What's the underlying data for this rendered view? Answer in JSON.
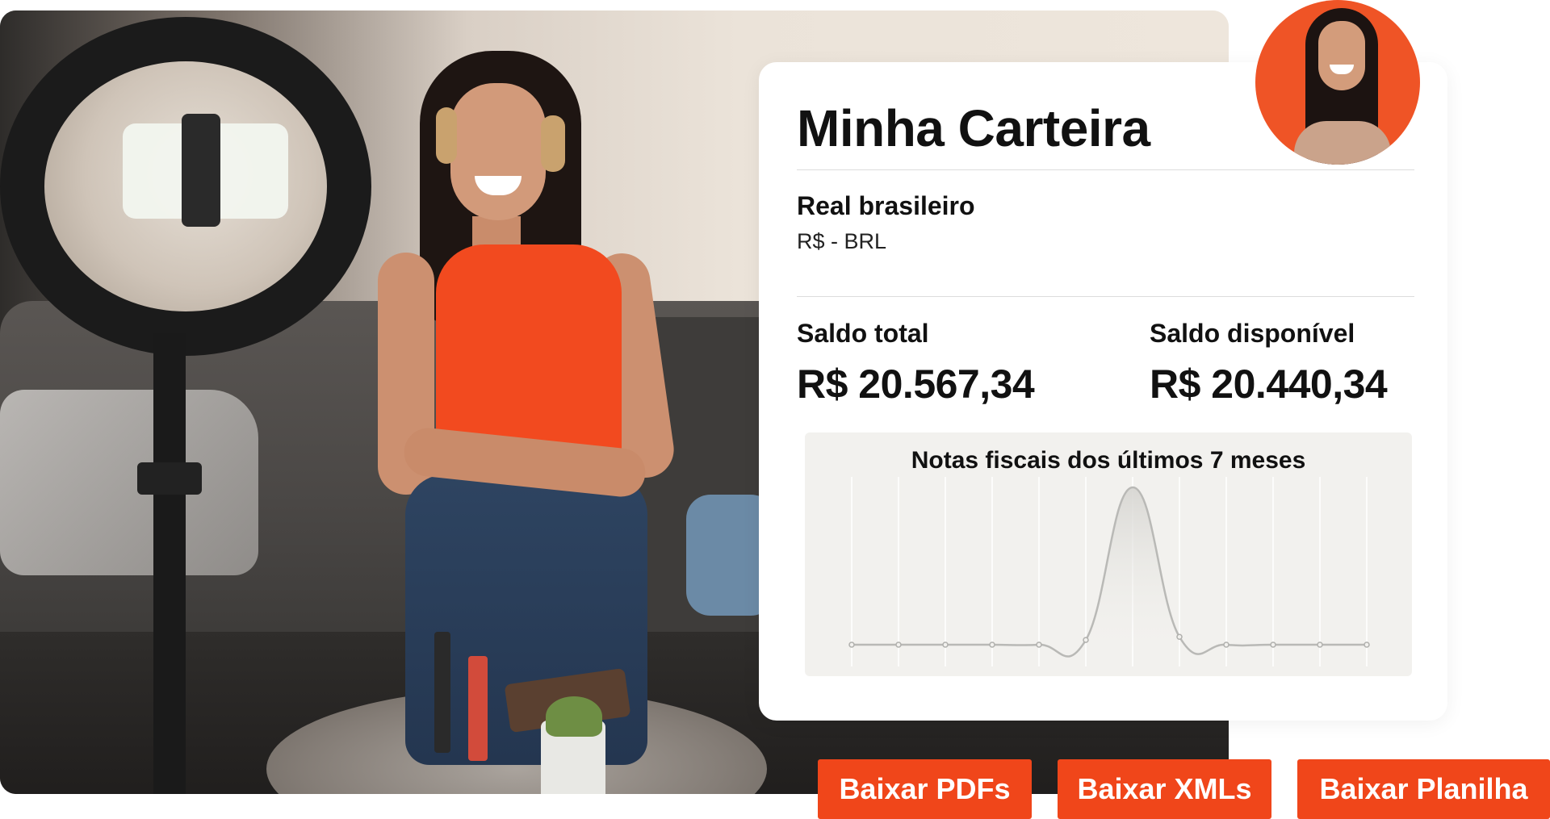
{
  "wallet": {
    "title": "Minha Carteira",
    "currency_name": "Real brasileiro",
    "currency_code": "R$ - BRL",
    "total_label": "Saldo total",
    "total_value": "R$ 20.567,34",
    "available_label": "Saldo disponível",
    "available_value": "R$ 20.440,34"
  },
  "actions": {
    "pdf": "Baixar PDFs",
    "xml": "Baixar XMLs",
    "sheet": "Baixar Planilha"
  },
  "colors": {
    "accent": "#f0461a",
    "avatar_bg": "#ef5426",
    "chart_panel": "#f2f1ee",
    "chart_line": "#b9b9b6"
  },
  "chart_data": {
    "type": "line",
    "title": "Notas fiscais dos últimos 7 meses",
    "x": [
      1,
      2,
      3,
      4,
      5,
      6,
      7,
      8,
      9,
      10,
      11,
      12
    ],
    "series": [
      {
        "values": [
          0,
          0,
          0,
          0,
          0,
          3,
          100,
          5,
          0,
          0,
          0,
          0
        ]
      }
    ],
    "grid": true,
    "legend": "none"
  }
}
